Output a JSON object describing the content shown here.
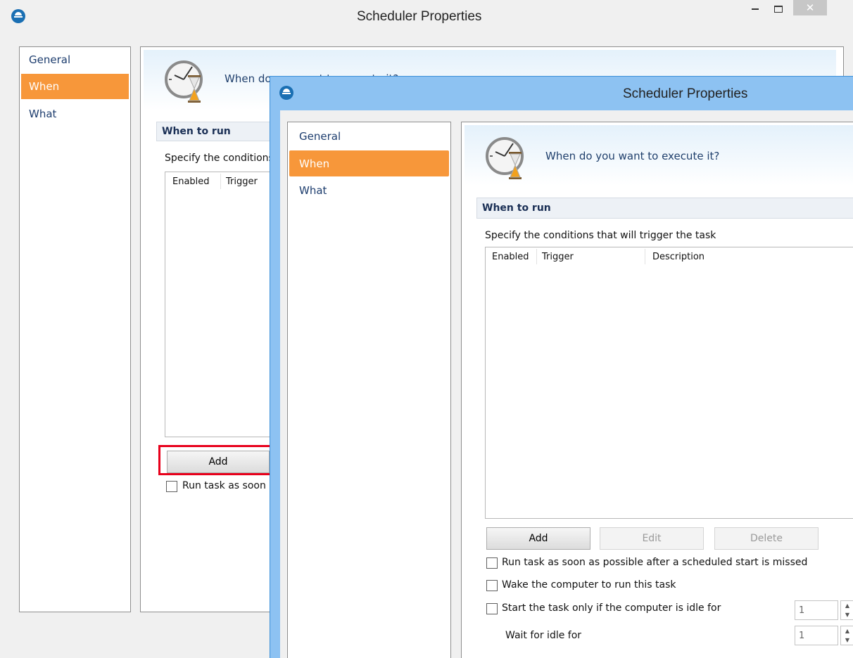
{
  "back_window": {
    "title": "Scheduler Properties",
    "nav": [
      "General",
      "When",
      "What"
    ],
    "banner_text": "When do you want to execute it?",
    "section_header": "When to run",
    "conditions_label": "Specify the conditions that will trigger the task",
    "columns": [
      "Enabled",
      "Trigger"
    ],
    "add_label": "Add",
    "checkbox_label": "Run task as soon as possible after a scheduled start is missed",
    "close_glyph": "✕"
  },
  "front_window": {
    "title": "Scheduler Properties",
    "nav": [
      "General",
      "When",
      "What"
    ],
    "banner_text": "When do you want to execute it?",
    "section_header": "When to run",
    "conditions_label": "Specify the conditions that will trigger the task",
    "columns": [
      "Enabled",
      "Trigger",
      "Description"
    ],
    "buttons": {
      "add": "Add",
      "edit": "Edit",
      "delete": "Delete"
    },
    "options": [
      "Run task as soon as possible after a scheduled start is missed",
      "Wake the computer to run this task",
      "Start the task only if the computer is idle for"
    ],
    "idle_value": "1",
    "wait_label": "Wait for idle for",
    "wait_value": "1",
    "spin_up": "▲",
    "spin_down": "▼"
  },
  "colors": {
    "nav_selected": "#f7973a",
    "annotation": "#e8001b",
    "front_frame": "#8dc2f2"
  },
  "icons": [
    "app-logo-icon",
    "clock-hourglass-icon",
    "minimize-icon",
    "maximize-icon",
    "close-icon",
    "checkbox-icon",
    "spin-up-icon",
    "spin-down-icon"
  ]
}
